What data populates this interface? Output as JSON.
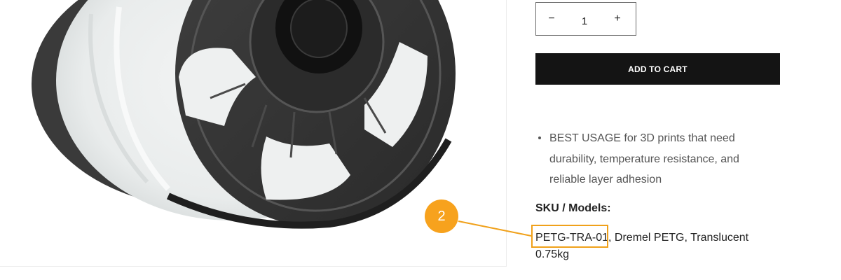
{
  "product_image": {
    "icon": "filament-spool-image"
  },
  "quantity": {
    "decrease_symbol": "−",
    "value": "1",
    "increase_symbol": "+"
  },
  "add_to_cart": {
    "label": "ADD TO CART"
  },
  "features": [
    "BEST USAGE for 3D prints that need durability, temperature resistance, and reliable layer adhesion"
  ],
  "sku": {
    "heading": "SKU / Models:",
    "code": "PETG-TRA-01",
    "description": ", Dremel PETG, Translucent 0.75kg"
  },
  "annotation": {
    "number": "2",
    "color": "#f7a21d"
  }
}
